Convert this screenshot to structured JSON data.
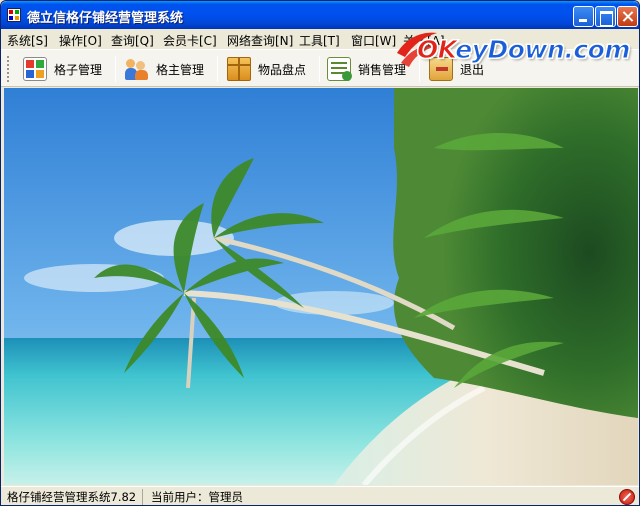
{
  "window": {
    "title": "德立信格仔铺经营管理系统"
  },
  "menu": [
    {
      "label": "系统[S]"
    },
    {
      "label": "操作[O]"
    },
    {
      "label": "查询[Q]"
    },
    {
      "label": "会员卡[C]"
    },
    {
      "label": "网络查询[N]"
    },
    {
      "label": "工具[T]"
    },
    {
      "label": "窗口[W]"
    },
    {
      "label": "关于[A]"
    }
  ],
  "toolbar": [
    {
      "label": "格子管理",
      "icon": "grid-icon"
    },
    {
      "label": "格主管理",
      "icon": "users-icon"
    },
    {
      "label": "物品盘点",
      "icon": "box-icon"
    },
    {
      "label": "销售管理",
      "icon": "sales-icon"
    },
    {
      "label": "退出",
      "icon": "exit-icon"
    }
  ],
  "watermark": {
    "text_ok": "OK",
    "text_rest": "eyDown.com"
  },
  "status": {
    "app_version": "格仔铺经营管理系统7.82",
    "current_user": "当前用户：管理员",
    "status_icon": "stop-icon"
  },
  "colors": {
    "titlebar": "#0053ee",
    "chrome": "#ece9d8",
    "sky": "#3b8fe0",
    "sea": "#4fd2d8",
    "sand": "#f1ead8"
  }
}
